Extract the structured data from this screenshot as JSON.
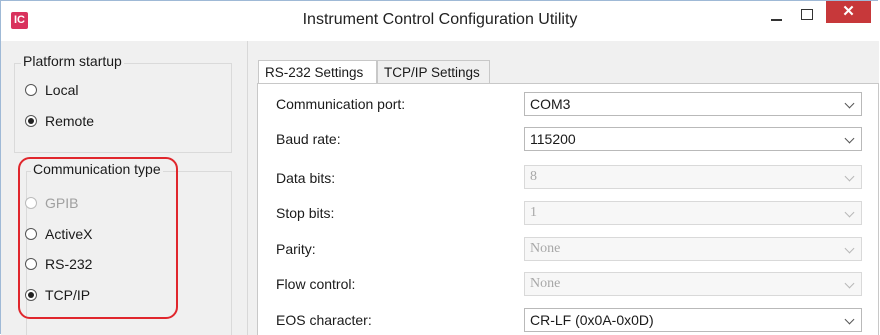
{
  "window": {
    "title": "Instrument Control Configuration Utility",
    "icon": "IC",
    "close_label": "✕"
  },
  "platform_startup": {
    "label": "Platform startup",
    "options": [
      {
        "label": "Local",
        "selected": false
      },
      {
        "label": "Remote",
        "selected": true
      }
    ]
  },
  "communication_type": {
    "label": "Communication type",
    "options": [
      {
        "label": "GPIB",
        "selected": false,
        "enabled": false
      },
      {
        "label": "ActiveX",
        "selected": false,
        "enabled": true
      },
      {
        "label": "RS-232",
        "selected": false,
        "enabled": true
      },
      {
        "label": "TCP/IP",
        "selected": true,
        "enabled": true
      }
    ]
  },
  "tabs": [
    {
      "label": "RS-232 Settings",
      "active": true
    },
    {
      "label": "TCP/IP Settings",
      "active": false
    }
  ],
  "rs232": {
    "fields": [
      {
        "label": "Communication port:",
        "value": "COM3",
        "enabled": true
      },
      {
        "label": "Baud rate:",
        "value": "115200",
        "enabled": true
      },
      {
        "label": "Data bits:",
        "value": "8",
        "enabled": false
      },
      {
        "label": "Stop bits:",
        "value": "1",
        "enabled": false
      },
      {
        "label": "Parity:",
        "value": "None",
        "enabled": false
      },
      {
        "label": "Flow control:",
        "value": "None",
        "enabled": false
      },
      {
        "label": "EOS character:",
        "value": "CR-LF (0x0A-0x0D)",
        "enabled": true
      }
    ]
  },
  "colors": {
    "highlight": "#e0262c",
    "close_button": "#c7383a",
    "app_icon": "#d9325d"
  }
}
